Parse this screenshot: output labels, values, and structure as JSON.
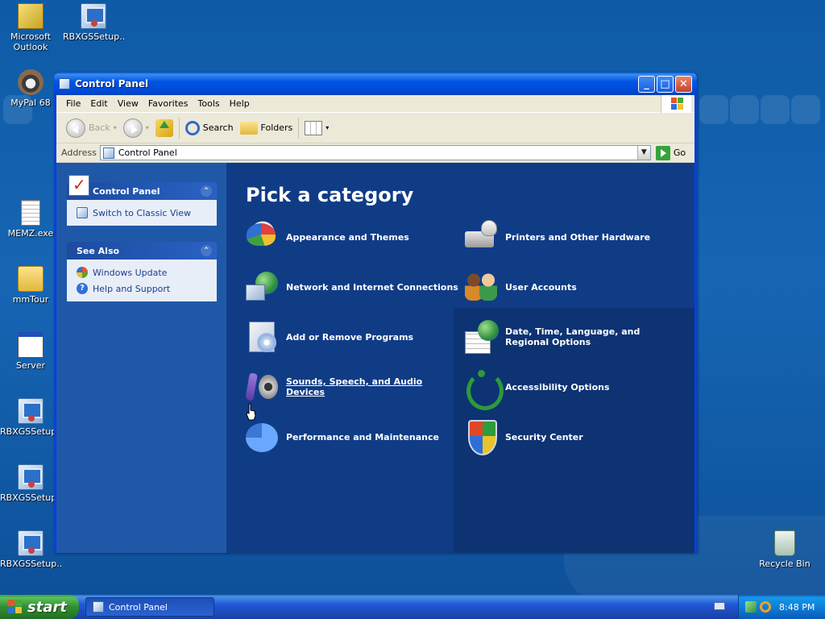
{
  "desktop": {
    "icons": [
      {
        "label": "Microsoft Outlook",
        "icon": "outlook-icon"
      },
      {
        "label": "RBXGSSetup....",
        "icon": "setup-icon"
      },
      {
        "label": "MyPal 68",
        "icon": "mypal-icon"
      },
      {
        "label": "MEMZ.exe",
        "icon": "file-icon"
      },
      {
        "label": "mmTour",
        "icon": "zip-folder-icon"
      },
      {
        "label": "Server",
        "icon": "window-icon"
      },
      {
        "label": "RBXGSSetup....",
        "icon": "setup-icon"
      },
      {
        "label": "RBXGSSetup....",
        "icon": "setup-icon"
      },
      {
        "label": "RBXGSSetup....",
        "icon": "setup-icon"
      },
      {
        "label": "Recycle Bin",
        "icon": "recycle-bin-icon"
      }
    ]
  },
  "window": {
    "title": "Control Panel",
    "menu": [
      "File",
      "Edit",
      "View",
      "Favorites",
      "Tools",
      "Help"
    ],
    "toolbar": {
      "back": "Back",
      "search": "Search",
      "folders": "Folders"
    },
    "address": {
      "label": "Address",
      "value": "Control Panel",
      "go": "Go"
    }
  },
  "taskpane": {
    "control_panel": {
      "title": "Control Panel",
      "links": [
        "Switch to Classic View"
      ]
    },
    "see_also": {
      "title": "See Also",
      "links": [
        "Windows Update",
        "Help and Support"
      ]
    }
  },
  "main": {
    "heading": "Pick a category",
    "categories_left": [
      {
        "label": "Appearance and Themes",
        "icon": "appearance-icon"
      },
      {
        "label": "Network and Internet Connections",
        "icon": "network-icon"
      },
      {
        "label": "Add or Remove Programs",
        "icon": "add-remove-icon"
      },
      {
        "label": "Sounds, Speech, and Audio Devices",
        "icon": "sound-icon"
      },
      {
        "label": "Performance and Maintenance",
        "icon": "performance-icon"
      }
    ],
    "categories_right": [
      {
        "label": "Printers and Other Hardware",
        "icon": "printer-icon"
      },
      {
        "label": "User Accounts",
        "icon": "users-icon"
      },
      {
        "label": "Date, Time, Language, and Regional Options",
        "icon": "date-globe-icon"
      },
      {
        "label": "Accessibility Options",
        "icon": "accessibility-icon"
      },
      {
        "label": "Security Center",
        "icon": "security-shield-icon"
      }
    ]
  },
  "taskbar": {
    "start": "start",
    "task": "Control Panel",
    "clock": "8:48 PM"
  },
  "colors": {
    "titlebar": "#0055e5",
    "main_pane": "#103c86",
    "taskpane": "#2058a8",
    "start_button": "#2f8f2f"
  }
}
